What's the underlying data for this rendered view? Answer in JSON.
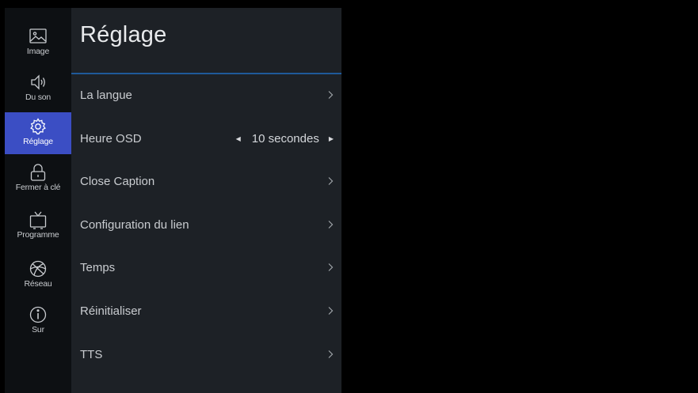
{
  "rail": {
    "items": [
      {
        "label": "Image",
        "icon": "image-icon",
        "active": false
      },
      {
        "label": "Du son",
        "icon": "speaker-icon",
        "active": false
      },
      {
        "label": "Réglage",
        "icon": "gear-icon",
        "active": true
      },
      {
        "label": "Fermer à clé",
        "icon": "lock-icon",
        "active": false
      },
      {
        "label": "Programme",
        "icon": "tv-icon",
        "active": false
      },
      {
        "label": "Réseau",
        "icon": "globe-icon",
        "active": false
      },
      {
        "label": "Sur",
        "icon": "info-icon",
        "active": false
      }
    ],
    "active_color": "#3b4ec4"
  },
  "panel": {
    "title": "Réglage",
    "divider_color": "#1f5a9a",
    "items": [
      {
        "label": "La langue"
      },
      {
        "label": "Heure OSD",
        "value": "10 secondes"
      },
      {
        "label": "Close Caption"
      },
      {
        "label": "Configuration du lien"
      },
      {
        "label": "Temps"
      },
      {
        "label": "Réinitialiser"
      },
      {
        "label": "TTS"
      }
    ]
  }
}
